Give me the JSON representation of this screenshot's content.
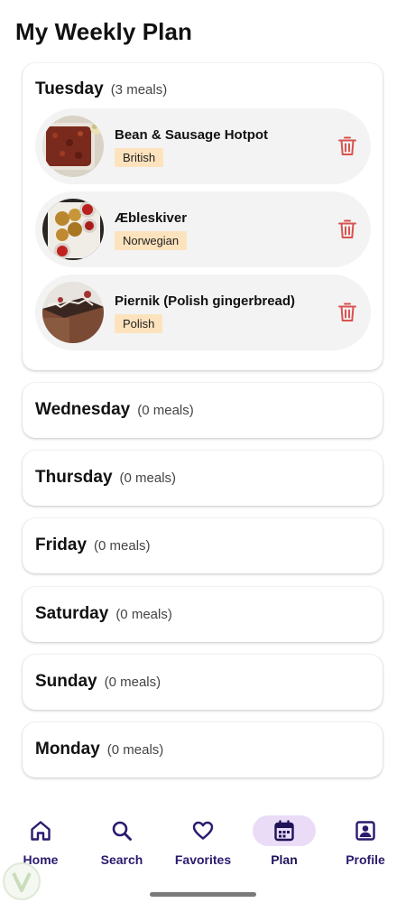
{
  "page": {
    "title": "My Weekly Plan"
  },
  "days": [
    {
      "name": "Tuesday",
      "count": "(3 meals)",
      "meals": [
        {
          "title": "Bean & Sausage Hotpot",
          "tag": "British",
          "image": "bean-hotpot-photo"
        },
        {
          "title": "Æbleskiver",
          "tag": "Norwegian",
          "image": "aebleskiver-photo"
        },
        {
          "title": "Piernik (Polish gingerbread)",
          "tag": "Polish",
          "image": "piernik-photo"
        }
      ]
    },
    {
      "name": "Wednesday",
      "count": "(0 meals)"
    },
    {
      "name": "Thursday",
      "count": "(0 meals)"
    },
    {
      "name": "Friday",
      "count": "(0 meals)"
    },
    {
      "name": "Saturday",
      "count": "(0 meals)"
    },
    {
      "name": "Sunday",
      "count": "(0 meals)"
    },
    {
      "name": "Monday",
      "count": "(0 meals)"
    }
  ],
  "nav": {
    "items": [
      {
        "label": "Home",
        "icon": "home-icon"
      },
      {
        "label": "Search",
        "icon": "search-icon"
      },
      {
        "label": "Favorites",
        "icon": "heart-icon"
      },
      {
        "label": "Plan",
        "icon": "calendar-icon",
        "active": true
      },
      {
        "label": "Profile",
        "icon": "profile-icon"
      }
    ]
  },
  "colors": {
    "accent": "#2b1a6e",
    "active_pill": "#eadcf7",
    "tag_bg": "#fde3bd",
    "delete": "#d9534f",
    "meal_bg": "#f3f3f3"
  }
}
